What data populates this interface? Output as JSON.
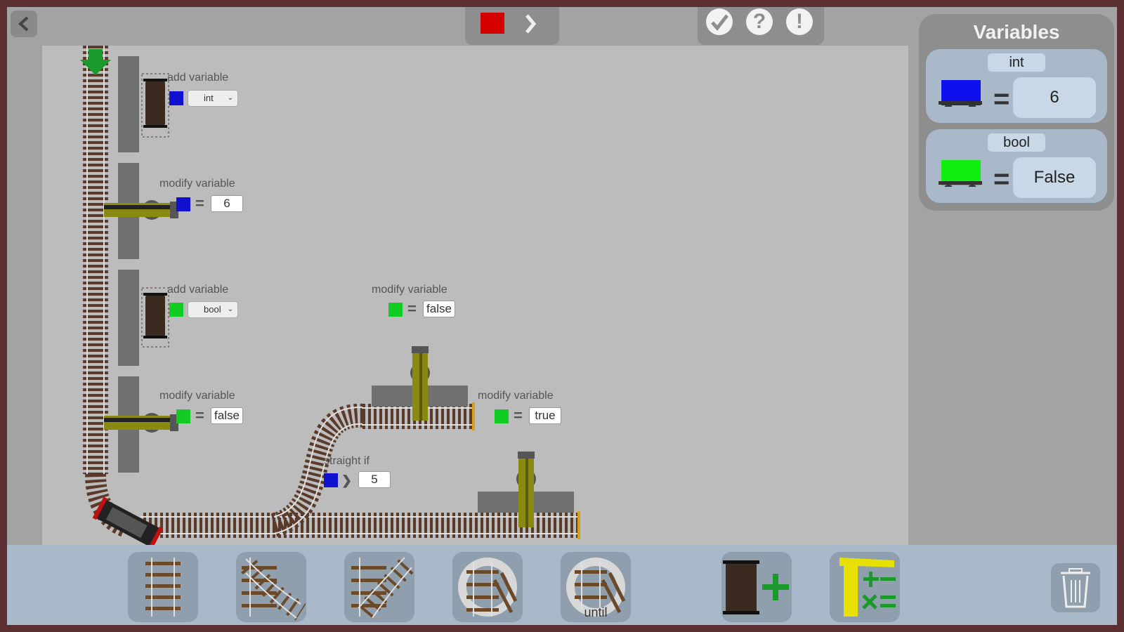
{
  "top": {
    "play_icon": "play-chevron-icon",
    "stop_icon": "stop-square-icon",
    "check_icon": "check-icon",
    "help_icon": "help-icon",
    "help_glyph": "?",
    "alert_icon": "alert-icon",
    "alert_glyph": "!"
  },
  "variables_panel": {
    "title": "Variables",
    "items": [
      {
        "type": "int",
        "color": "#1010ee",
        "eq": "=",
        "value": "6"
      },
      {
        "type": "bool",
        "color": "#11ee11",
        "eq": "=",
        "value": "False"
      }
    ]
  },
  "blocks": {
    "add_int": {
      "label": "add variable",
      "color": "#1010d0",
      "type": "int"
    },
    "modify_int": {
      "label": "modify variable",
      "color": "#1010d0",
      "eq": "=",
      "value": "6"
    },
    "add_bool": {
      "label": "add variable",
      "color": "#11cc22",
      "type": "bool"
    },
    "modify_bool_1": {
      "label": "modify variable",
      "color": "#11cc22",
      "eq": "=",
      "value": "false"
    },
    "modify_bool_2": {
      "label": "modify variable",
      "color": "#11cc22",
      "eq": "=",
      "value": "false"
    },
    "modify_bool_3": {
      "label": "modify variable",
      "color": "#11cc22",
      "eq": "=",
      "value": "true"
    },
    "straight_if": {
      "label": "straight if",
      "color": "#1010d0",
      "op": "❯",
      "value": "5"
    }
  },
  "toolbar": {
    "items": [
      {
        "name": "straight-track"
      },
      {
        "name": "curve-left-track"
      },
      {
        "name": "curve-right-track"
      },
      {
        "name": "loop-track"
      },
      {
        "name": "until-loop-track",
        "label": "until"
      },
      {
        "name": "add-wagon"
      },
      {
        "name": "variable-crane"
      }
    ],
    "trash_icon": "trash-icon"
  }
}
